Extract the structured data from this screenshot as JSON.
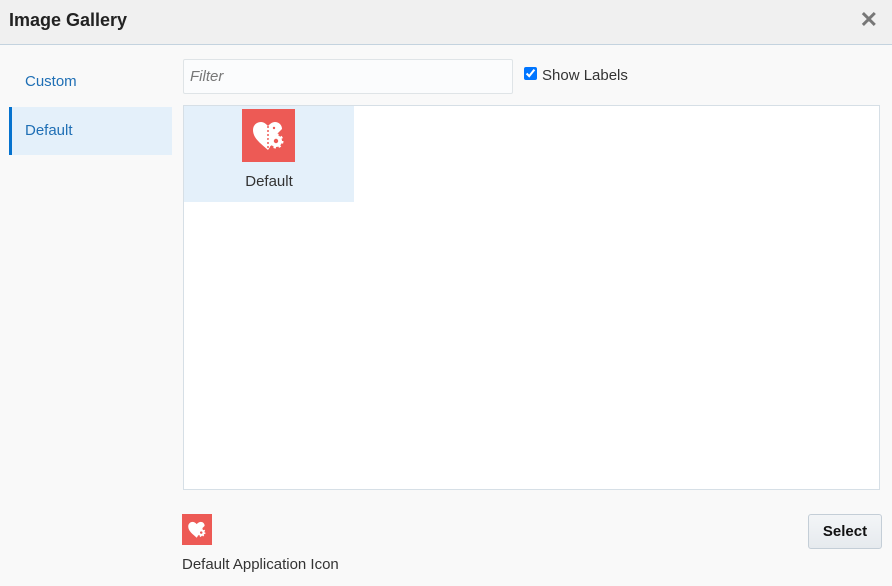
{
  "dialog": {
    "title": "Image Gallery",
    "close_icon": "close-icon"
  },
  "sidebar": {
    "items": [
      {
        "label": "Custom",
        "active": false
      },
      {
        "label": "Default",
        "active": true
      }
    ]
  },
  "toolbar": {
    "filter_placeholder": "Filter",
    "filter_value": "",
    "show_labels_label": "Show Labels",
    "show_labels_checked": true
  },
  "gallery": {
    "items": [
      {
        "label": "Default",
        "icon": "heart-gear-icon",
        "selected": true
      }
    ]
  },
  "preview": {
    "icon": "heart-gear-icon",
    "caption": "Default Application Icon"
  },
  "footer": {
    "select_label": "Select"
  },
  "colors": {
    "accent": "#0572ce",
    "icon_bg": "#ed5a55",
    "selected_bg": "#e4f0fa"
  }
}
